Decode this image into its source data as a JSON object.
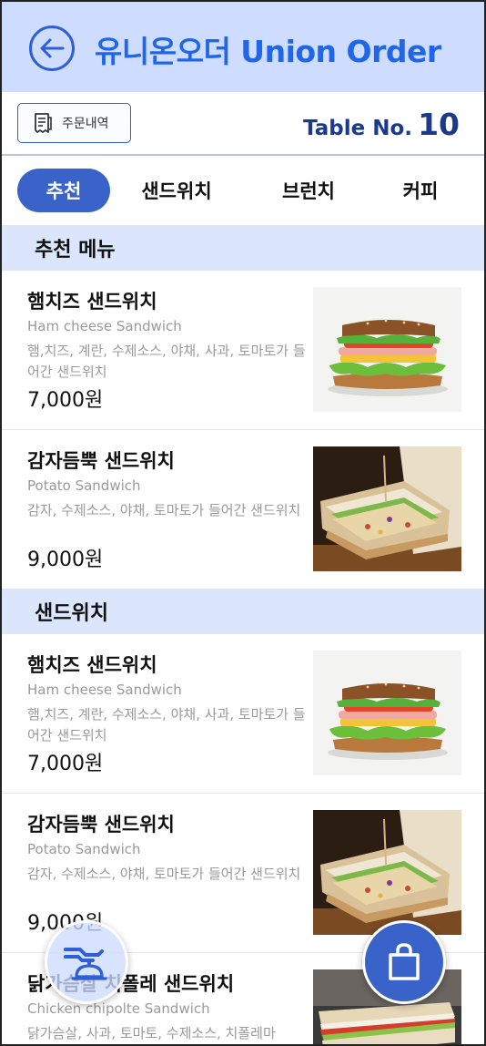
{
  "header": {
    "title": "유니온오더 Union Order",
    "back_icon": "arrow-left-icon"
  },
  "subbar": {
    "history_label": "주문내역",
    "history_icon": "receipt-icon",
    "table_label": "Table No.",
    "table_number": "10"
  },
  "tabs": [
    {
      "label": "추천",
      "active": true
    },
    {
      "label": "샌드위치",
      "active": false
    },
    {
      "label": "브런치",
      "active": false
    },
    {
      "label": "커피",
      "active": false
    }
  ],
  "sections": [
    {
      "title": "추천 메뉴",
      "items": [
        {
          "name": "햄치즈 샌드위치",
          "name_en": "Ham cheese Sandwich",
          "desc": "햄,치즈, 계란, 수제소스, 야채, 사과, 토마토가 들어간 샌드위치",
          "price": "7,000원",
          "image": "ham-cheese-sandwich"
        },
        {
          "name": "감자듬뿍 샌드위치",
          "name_en": "Potato Sandwich",
          "desc": "감자, 수제소스, 야채, 토마토가 들어간 샌드위치",
          "price": "9,000원",
          "image": "potato-sandwich"
        }
      ]
    },
    {
      "title": "샌드위치",
      "items": [
        {
          "name": "햄치즈 샌드위치",
          "name_en": "Ham cheese Sandwich",
          "desc": "햄,치즈, 계란, 수제소스, 야채, 사과, 토마토가 들어간 샌드위치",
          "price": "7,000원",
          "image": "ham-cheese-sandwich"
        },
        {
          "name": "감자듬뿍 샌드위치",
          "name_en": "Potato Sandwich",
          "desc": "감자, 수제소스, 야채, 토마토가 들어간 샌드위치",
          "price": "9,000원",
          "image": "potato-sandwich"
        },
        {
          "name": "닭가슴살 치폴레 샌드위치",
          "name_en": "Chicken chipolte Sandwich",
          "desc": "닭가슴살, 사과, 토마토, 수제소스, 치폴레마",
          "price": "",
          "image": "chicken-sandwich"
        }
      ]
    }
  ],
  "fab": {
    "staff_call_icon": "staff-call-bell-icon",
    "cart_icon": "shopping-bag-icon"
  },
  "colors": {
    "primary": "#3a63c9",
    "title_blue": "#2066e6",
    "header_bg": "#cddcff",
    "section_bg": "#dbe6fd"
  }
}
